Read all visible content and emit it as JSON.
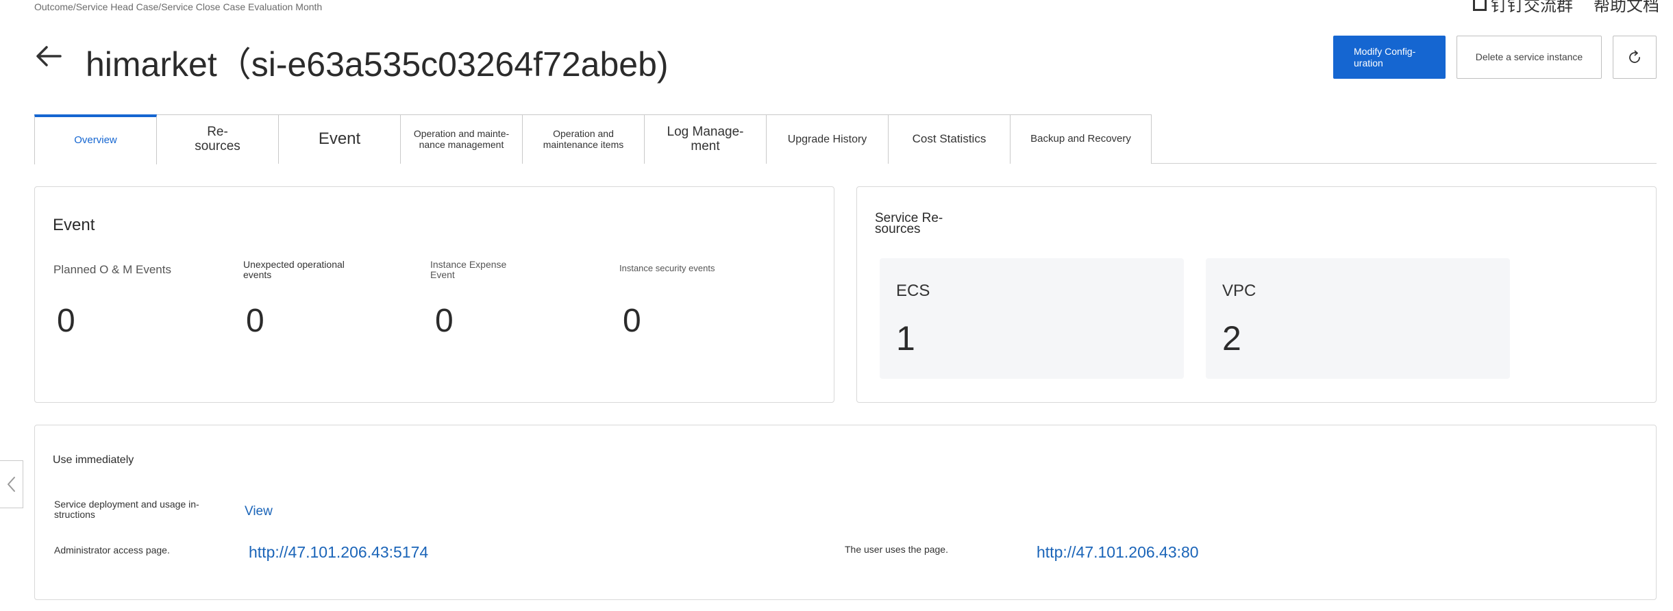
{
  "breadcrumb": "Outcome/Service Head Case/Service Close Case Evaluation Month",
  "top_links": [
    "钉钉交流群",
    "帮助文档"
  ],
  "title": "himarket（si-e63a535c03264f72abeb)",
  "actions": {
    "modify": "Modify Config-\nuration",
    "delete": "Delete a service instance"
  },
  "tabs": [
    {
      "label": "Overview"
    },
    {
      "label": "Re-\nsources"
    },
    {
      "label": "Event"
    },
    {
      "label": "Operation and mainte-\nnance management"
    },
    {
      "label": "Operation and\nmaintenance items"
    },
    {
      "label": "Log Manage-\nment"
    },
    {
      "label": "Upgrade History"
    },
    {
      "label": "Cost Statistics"
    },
    {
      "label": "Backup and Recovery"
    }
  ],
  "event_card": {
    "title": "Event",
    "stats": [
      {
        "label": "Planned O & M Events",
        "value": "0"
      },
      {
        "label": "Unexpected operational\nevents",
        "value": "0"
      },
      {
        "label": "Instance Expense\nEvent",
        "value": "0"
      },
      {
        "label": "Instance security events",
        "value": "0"
      }
    ]
  },
  "resources_card": {
    "title": "Service Re-\nsources",
    "items": [
      {
        "name": "ECS",
        "count": "1"
      },
      {
        "name": "VPC",
        "count": "2"
      }
    ]
  },
  "use_card": {
    "title": "Use immediately",
    "deploy_label": "Service deployment and usage in-\nstructions",
    "deploy_link": "View",
    "admin_label": "Administrator access page.",
    "admin_url": "http://47.101.206.43:5174",
    "user_label": "The user uses the page.",
    "user_url": "http://47.101.206.43:80"
  },
  "colors": {
    "primary": "#1566d1",
    "link": "#1a64b8"
  }
}
